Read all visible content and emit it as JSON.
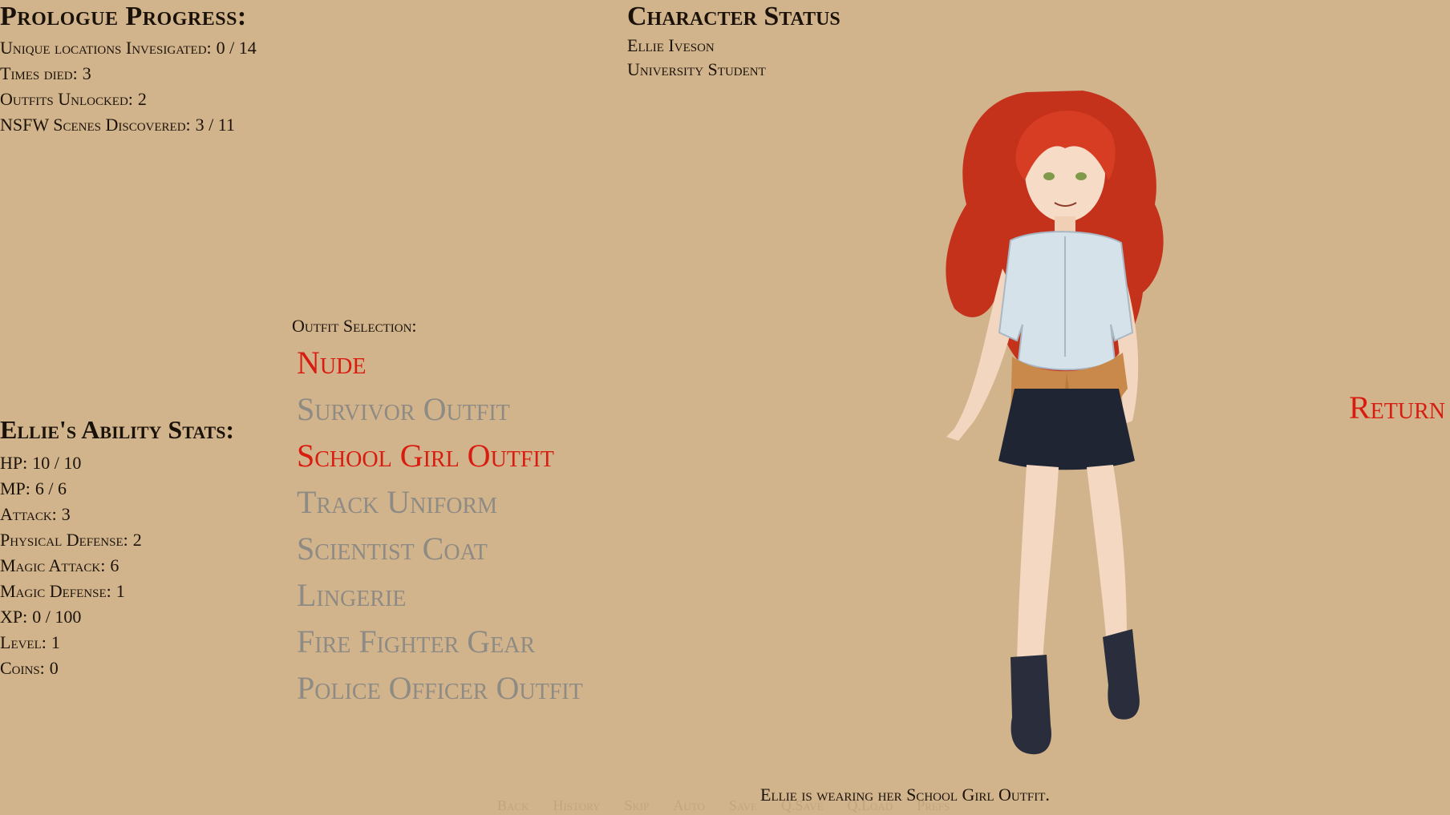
{
  "progress": {
    "title": "Prologue Progress:",
    "items": [
      {
        "label": "Unique locations Invesigated:",
        "value": "0 / 14"
      },
      {
        "label": "Times died:",
        "value": "3"
      },
      {
        "label": "Outfits Unlocked:",
        "value": "2"
      },
      {
        "label": "NSFW Scenes Discovered:",
        "value": "3 / 11"
      }
    ]
  },
  "abilities": {
    "title": "Ellie's Ability Stats:",
    "items": [
      {
        "label": "HP:",
        "value": "10 / 10"
      },
      {
        "label": "MP:",
        "value": "6 / 6"
      },
      {
        "label": "Attack:",
        "value": "3"
      },
      {
        "label": "Physical Defense:",
        "value": "2"
      },
      {
        "label": "Magic Attack:",
        "value": "6"
      },
      {
        "label": "Magic Defense:",
        "value": "1"
      },
      {
        "label": "XP:",
        "value": "0 / 100"
      },
      {
        "label": "Level:",
        "value": "1"
      },
      {
        "label": "Coins:",
        "value": "0"
      }
    ]
  },
  "outfits": {
    "heading": "Outfit Selection:",
    "items": [
      {
        "label": "Nude",
        "unlocked": true
      },
      {
        "label": "Survivor Outfit",
        "unlocked": false
      },
      {
        "label": "School Girl Outfit",
        "unlocked": true
      },
      {
        "label": "Track Uniform",
        "unlocked": false
      },
      {
        "label": "Scientist Coat",
        "unlocked": false
      },
      {
        "label": "Lingerie",
        "unlocked": false
      },
      {
        "label": "Fire Fighter Gear",
        "unlocked": false
      },
      {
        "label": "Police Officer Outfit",
        "unlocked": false
      }
    ]
  },
  "character": {
    "title": "Character Status",
    "name": "Ellie Iveson",
    "occupation": "University Student"
  },
  "return_label": "Return",
  "caption": "Ellie is wearing her School Girl Outfit.",
  "quick_menu": [
    "Back",
    "History",
    "Skip",
    "Auto",
    "Save",
    "Q.Save",
    "Q.Load",
    "Prefs"
  ],
  "colors": {
    "background": "#d2b48c",
    "active": "#d91c10",
    "inactive": "#8e8a84",
    "text": "#1a1209"
  }
}
